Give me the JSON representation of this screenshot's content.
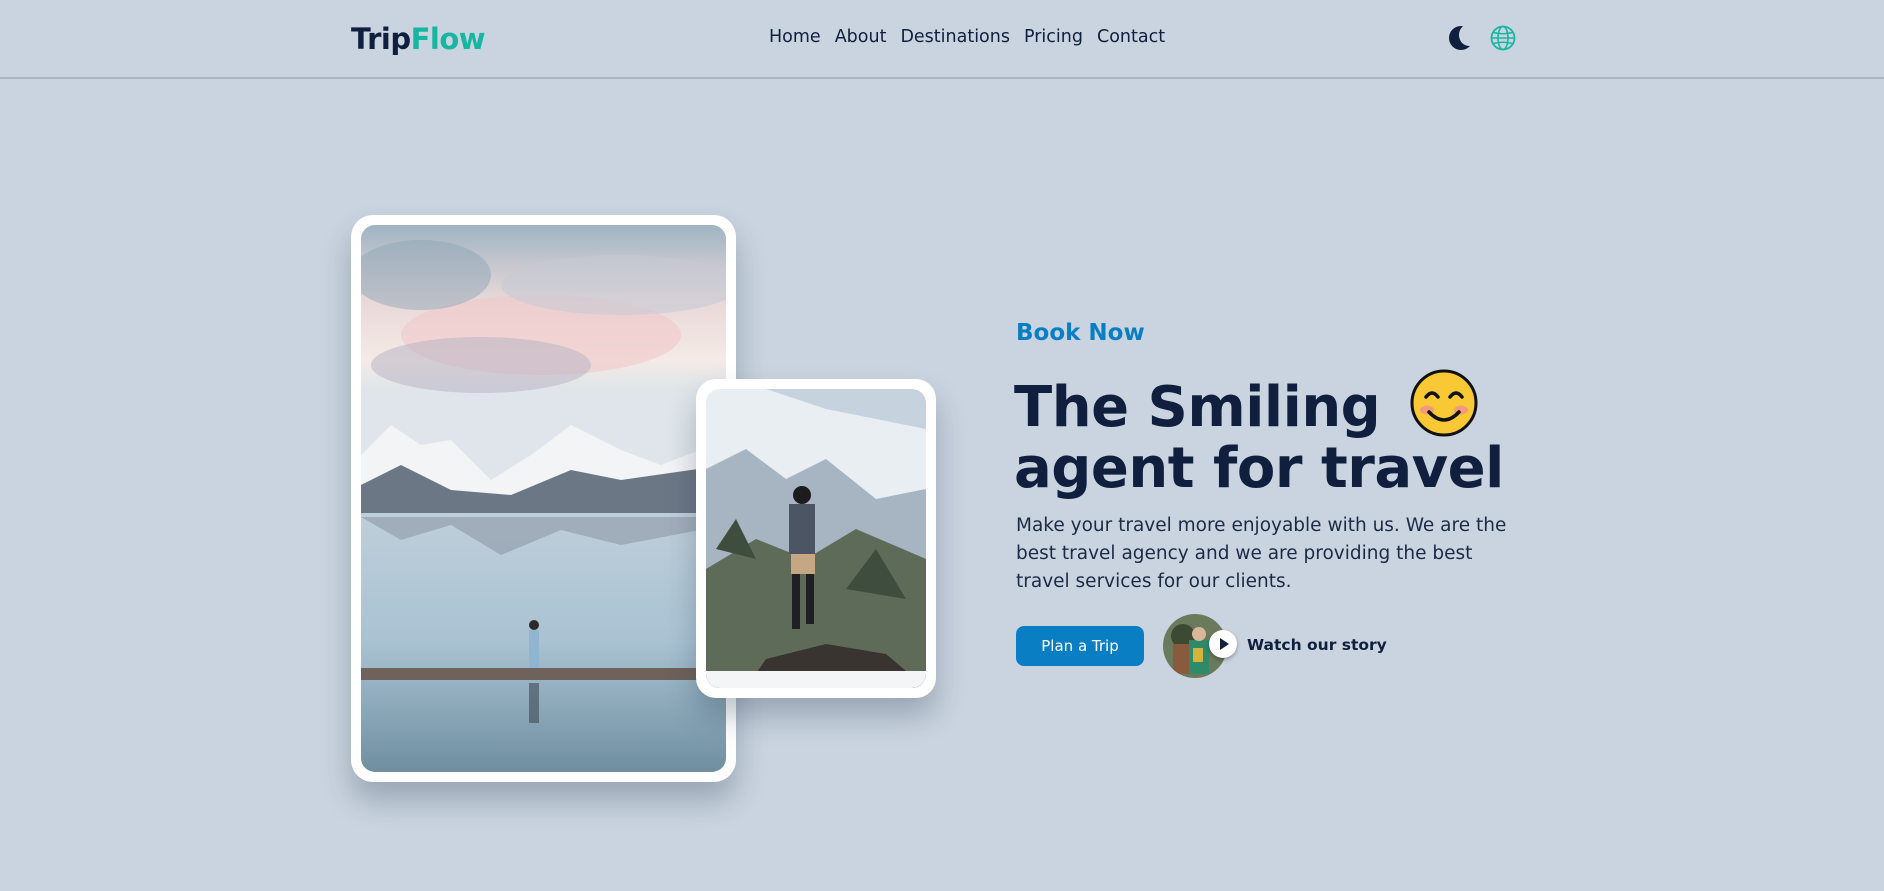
{
  "header": {
    "logo_part1": "Trip",
    "logo_part2": "Flow",
    "nav": [
      "Home",
      "About",
      "Destinations",
      "Pricing",
      "Contact"
    ],
    "icons": [
      "moon-icon",
      "globe-icon"
    ]
  },
  "hero": {
    "eyebrow": "Book Now",
    "headline_line1": "The Smiling",
    "headline_line2": "agent for travel",
    "description": "Make your travel more enjoyable with us. We are the best travel agency and we are providing the best travel services for our clients.",
    "cta_label": "Plan a Trip",
    "story_label": "Watch our story"
  },
  "colors": {
    "background": "#cad4e0",
    "brand_dark": "#0f1f3d",
    "brand_accent": "#17b6a0",
    "primary": "#0a7ec2"
  }
}
